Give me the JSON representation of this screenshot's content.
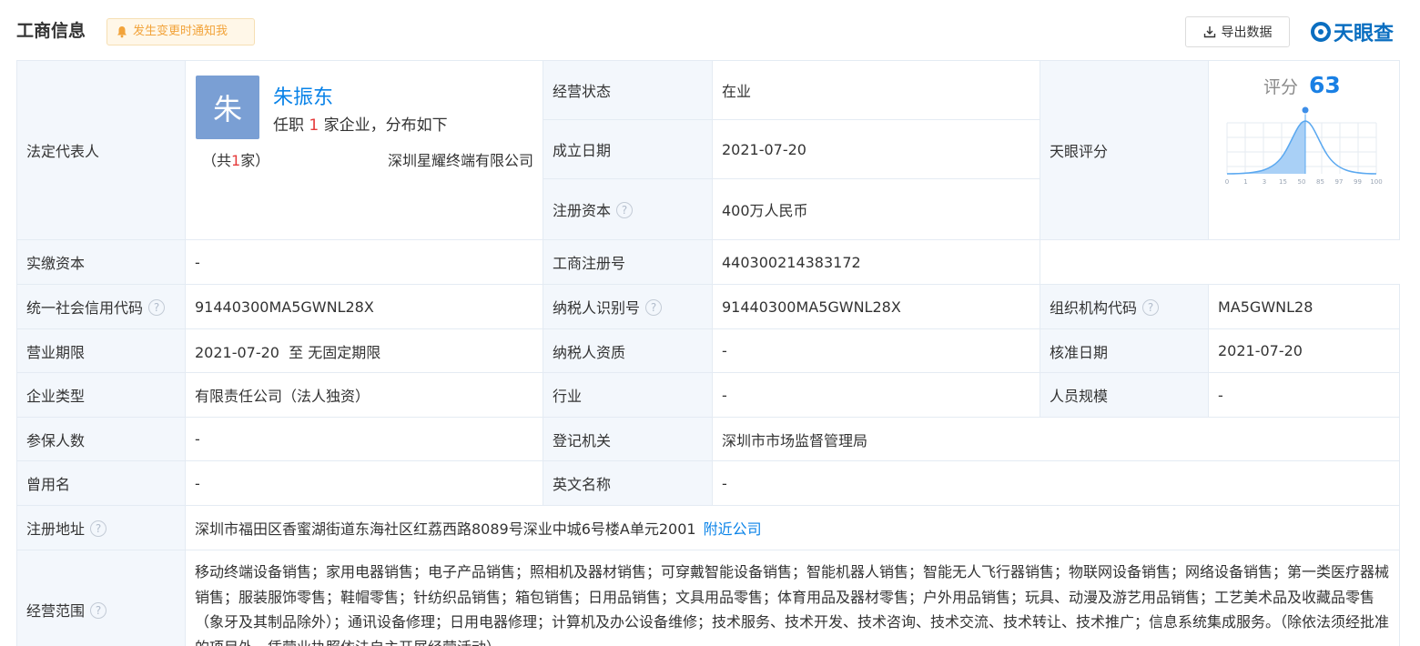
{
  "header": {
    "title": "工商信息",
    "notify_label": "发生变更时通知我",
    "notify_icon": "bell-icon",
    "export_label": "导出数据",
    "export_icon": "download-icon",
    "logo_text": "天眼查"
  },
  "colors": {
    "accent": "#0a83e8",
    "label_bg": "#f3f7fc",
    "border": "#e4ebf3",
    "notify_text": "#f2a33a",
    "highlight_red": "#e53b3b",
    "avatar_bg": "#7a9fd4"
  },
  "legal_rep": {
    "label": "法定代表人",
    "avatar_char": "朱",
    "name": "朱振东",
    "desc_prefix": "任职",
    "desc_count": "1",
    "desc_suffix": "家企业，分布如下",
    "count_prefix": "（共",
    "count_num": "1",
    "count_suffix": "家）",
    "company": "深圳星耀终端有限公司"
  },
  "fields": {
    "status": {
      "label": "经营状态",
      "value": "在业"
    },
    "founded": {
      "label": "成立日期",
      "value": "2021-07-20"
    },
    "reg_capital": {
      "label": "注册资本",
      "value": "400万人民币"
    },
    "paid_capital": {
      "label": "实缴资本",
      "value": "-"
    },
    "score": {
      "label": "天眼评分",
      "head_label": "评分",
      "value": "63",
      "axis_ticks": [
        "0",
        "1",
        "3",
        "15",
        "50",
        "85",
        "97",
        "99",
        "100"
      ]
    },
    "reg_no": {
      "label": "工商注册号",
      "value": "440300214383172"
    },
    "credit_code": {
      "label": "统一社会信用代码",
      "value": "91440300MA5GWNL28X"
    },
    "taxpayer_id": {
      "label": "纳税人识别号",
      "value": "91440300MA5GWNL28X"
    },
    "org_code": {
      "label": "组织机构代码",
      "value": "MA5GWNL28"
    },
    "term": {
      "label": "营业期限",
      "value": "2021-07-20  至 无固定期限"
    },
    "taxpayer_qual": {
      "label": "纳税人资质",
      "value": "-"
    },
    "approve_date": {
      "label": "核准日期",
      "value": "2021-07-20"
    },
    "company_type": {
      "label": "企业类型",
      "value": "有限责任公司（法人独资）"
    },
    "industry": {
      "label": "行业",
      "value": "-"
    },
    "staff_size": {
      "label": "人员规模",
      "value": "-"
    },
    "insured": {
      "label": "参保人数",
      "value": "-"
    },
    "reg_authority": {
      "label": "登记机关",
      "value": "深圳市市场监督管理局"
    },
    "former_name": {
      "label": "曾用名",
      "value": "-"
    },
    "english_name": {
      "label": "英文名称",
      "value": "-"
    },
    "address": {
      "label": "注册地址",
      "value": "深圳市福田区香蜜湖街道东海社区红荔西路8089号深业中城6号楼A单元2001",
      "link": "附近公司"
    },
    "scope": {
      "label": "经营范围",
      "value": "移动终端设备销售；家用电器销售；电子产品销售；照相机及器材销售；可穿戴智能设备销售；智能机器人销售；智能无人飞行器销售；物联网设备销售；网络设备销售；第一类医疗器械销售；服装服饰零售；鞋帽零售；针纺织品销售；箱包销售；日用品销售；文具用品零售；体育用品及器材零售；户外用品销售；玩具、动漫及游艺用品销售；工艺美术品及收藏品零售（象牙及其制品除外）；通讯设备修理；日用电器修理；计算机及办公设备维修；技术服务、技术开发、技术咨询、技术交流、技术转让、技术推广；信息系统集成服务。（除依法须经批准的项目外，凭营业执照依法自主开展经营活动）"
    }
  }
}
